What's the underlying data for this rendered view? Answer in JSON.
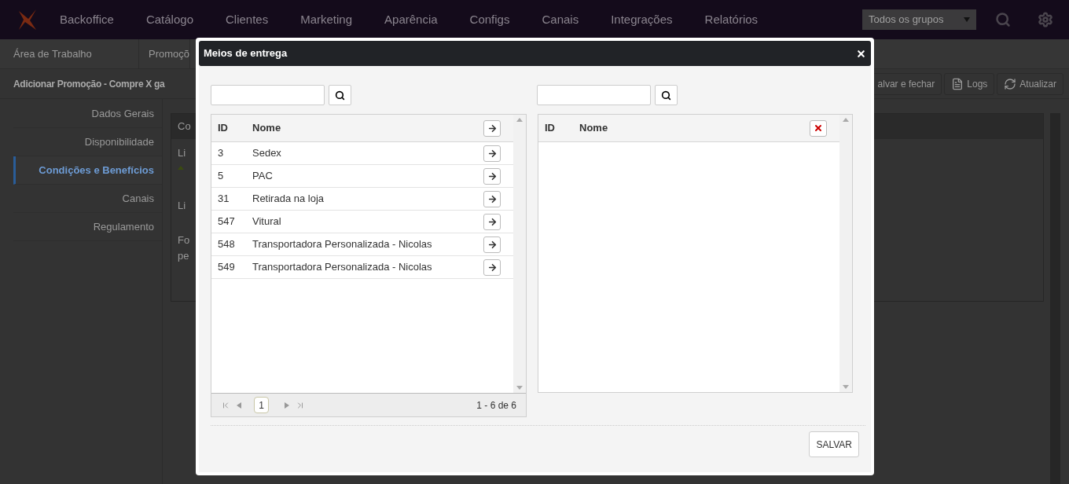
{
  "nav": {
    "brand": "Backoffice",
    "items": [
      "Catálogo",
      "Clientes",
      "Marketing",
      "Aparência",
      "Configs",
      "Canais",
      "Integrações",
      "Relatórios"
    ],
    "group_select": "Todos os grupos"
  },
  "subnav": {
    "tabs": [
      "Área de Trabalho",
      "Promoçõ"
    ]
  },
  "page": {
    "title": "Adicionar Promoção - Compre X ga",
    "toolbar": [
      {
        "kind": "save",
        "label": "alvar e fechar"
      },
      {
        "kind": "logs",
        "label": "Logs"
      },
      {
        "kind": "refresh",
        "label": "Atualizar"
      }
    ]
  },
  "sidebar": {
    "items": [
      {
        "label": "Dados Gerais",
        "selected": false
      },
      {
        "label": "Disponibilidade",
        "selected": false
      },
      {
        "label": "Condições e Benefícios",
        "selected": true
      },
      {
        "label": "Canais",
        "selected": false
      },
      {
        "label": "Regulamento",
        "selected": false
      }
    ]
  },
  "content": {
    "header": "Co",
    "lines": [
      "Li",
      "Li",
      "Fo",
      "pe"
    ]
  },
  "modal": {
    "title": "Meios de entrega",
    "left": {
      "columns": [
        "ID",
        "Nome"
      ],
      "rows": [
        {
          "id": "3",
          "name": "Sedex"
        },
        {
          "id": "5",
          "name": "PAC"
        },
        {
          "id": "31",
          "name": "Retirada na loja"
        },
        {
          "id": "547",
          "name": "Vitural"
        },
        {
          "id": "548",
          "name": "Transportadora Personalizada - Nicolas"
        },
        {
          "id": "549",
          "name": "Transportadora Personalizada - Nicolas"
        }
      ],
      "pager": {
        "pages": [
          {
            "label": "1",
            "selected": true
          }
        ],
        "count": "1 - 6 de 6"
      }
    },
    "right": {
      "columns": [
        "ID",
        "Nome"
      ]
    },
    "save": "SALVAR"
  }
}
